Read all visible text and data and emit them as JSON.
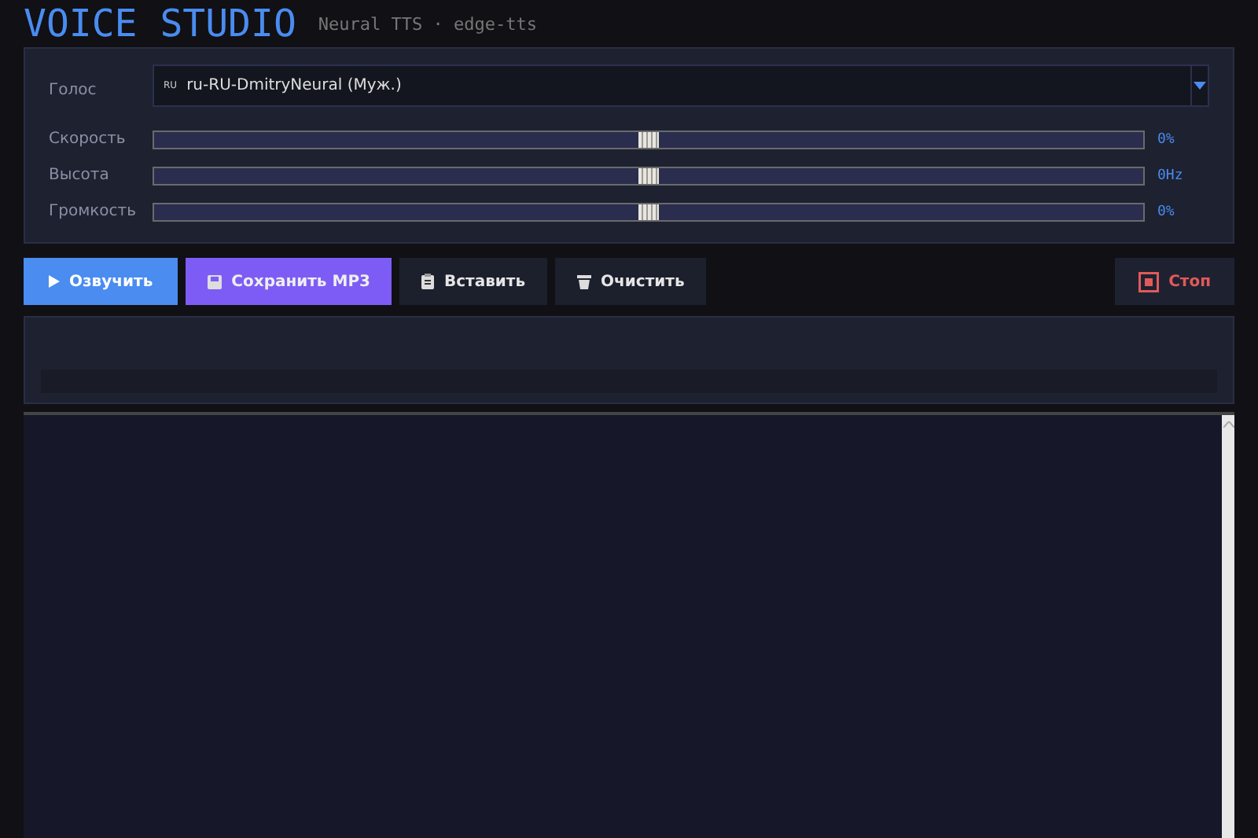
{
  "header": {
    "title": "VOICE STUDIO",
    "subtitle": "Neural TTS · edge-tts"
  },
  "voice": {
    "label": "Голос",
    "flag": "RU",
    "value": "ru-RU-DmitryNeural  (Муж.)"
  },
  "sliders": [
    {
      "label": "Скорость",
      "level": 0.5,
      "reading": "0%"
    },
    {
      "label": "Высота",
      "level": 0.5,
      "reading": "0Hz"
    },
    {
      "label": "Громкость",
      "level": 0.5,
      "reading": "0%"
    }
  ],
  "buttons": [
    {
      "kind": "play",
      "label": "Озвучить"
    },
    {
      "kind": "save",
      "label": "Сохранить MP3"
    },
    {
      "kind": "paste",
      "label": "Вставить"
    },
    {
      "kind": "clear",
      "label": "Очистить"
    }
  ],
  "stop_button": {
    "label": "Стоп"
  },
  "progress": {
    "level": 0
  }
}
